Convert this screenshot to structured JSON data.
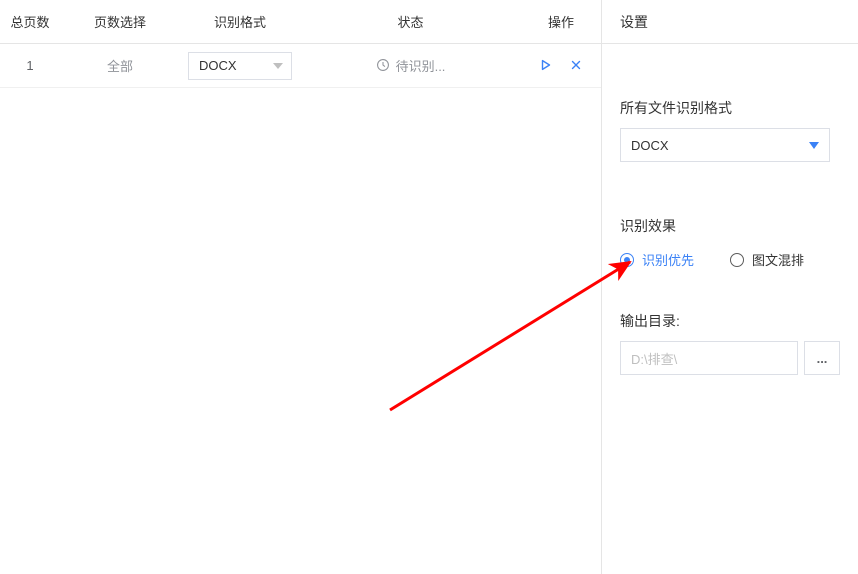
{
  "table": {
    "headers": {
      "total_pages": "总页数",
      "page_select": "页数选择",
      "format": "识别格式",
      "status": "状态",
      "ops": "操作"
    },
    "rows": [
      {
        "total_pages": "1",
        "page_select": "全部",
        "format": "DOCX",
        "status": "待识别..."
      }
    ]
  },
  "side": {
    "title": "设置",
    "all_format_label": "所有文件识别格式",
    "all_format_value": "DOCX",
    "effect_label": "识别效果",
    "effect_options": {
      "priority": "识别优先",
      "mixed": "图文混排"
    },
    "output_label": "输出目录:",
    "output_placeholder": "D:\\排查\\",
    "browse": "..."
  }
}
